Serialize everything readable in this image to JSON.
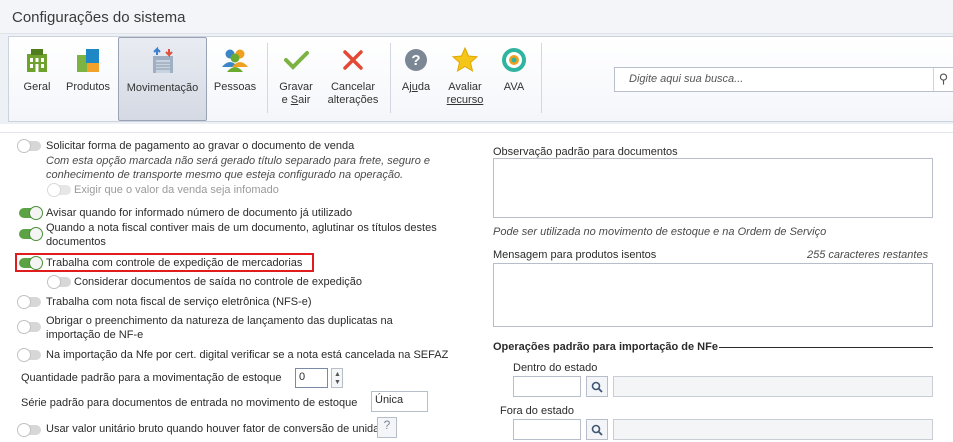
{
  "window": {
    "title": "Configurações do sistema"
  },
  "ribbon": {
    "geral": "Geral",
    "produtos": "Produtos",
    "movimentacao": "Movimentação",
    "pessoas": "Pessoas",
    "gravar_line1": "Gravar",
    "gravar_line2_pre": "e ",
    "gravar_line2_u": "S",
    "gravar_line2_post": "air",
    "cancelar_line1": "Cancelar",
    "cancelar_line2": "alterações",
    "ajuda_pre": "Aj",
    "ajuda_u": "u",
    "ajuda_post": "da",
    "avaliar_line1": "Avaliar",
    "avaliar_line2": "recurso",
    "ava": "AVA"
  },
  "search": {
    "placeholder": "Digite aqui sua busca..."
  },
  "options": {
    "pagamento": "Solicitar forma de pagamento ao gravar o documento de venda",
    "pagamento_desc1": "Com esta opção marcada não será gerado título separado para frete, seguro e",
    "pagamento_desc2": "conhecimento de transporte mesmo que esteja configurado na operação.",
    "exigir_valor": "Exigir que o valor da venda seja infomado",
    "avisar_documento": "Avisar quando for informado número de documento já utilizado",
    "aglutinar_line1": "Quando a nota fiscal contiver mais de um documento, aglutinar os títulos destes",
    "aglutinar_line2": "documentos",
    "controle_expedicao": "Trabalha com controle de expedição de mercadorias",
    "considerar_saida": "Considerar documentos de saída no controle de expedição",
    "nfse": "Trabalha com nota fiscal de serviço eletrônica (NFS-e)",
    "natureza_line1": "Obrigar o preenchimento da natureza de lançamento das duplicatas na",
    "natureza_line2": "importação de NF-e",
    "sefaz": "Na importação da Nfe por cert. digital verificar se a nota está cancelada na SEFAZ",
    "quantidade_label": "Quantidade padrão para a movimentação de estoque",
    "quantidade_value": "0",
    "serie_label": "Série padrão para documentos de entrada no movimento de estoque",
    "serie_value": "Única",
    "valor_unitario": "Usar valor unitário bruto quando houver fator de conversão de unidade",
    "help_glyph": "?"
  },
  "right": {
    "obs_label": "Observação padrão para documentos",
    "obs_hint": "Pode ser utilizada no movimento de estoque e na Ordem de Serviço",
    "msg_label": "Mensagem para produtos isentos",
    "msg_counter": "255 caracteres restantes",
    "operacoes_title": "Operações padrão para importação de NFe",
    "dentro_label": "Dentro do estado",
    "fora_label": "Fora do estado"
  }
}
